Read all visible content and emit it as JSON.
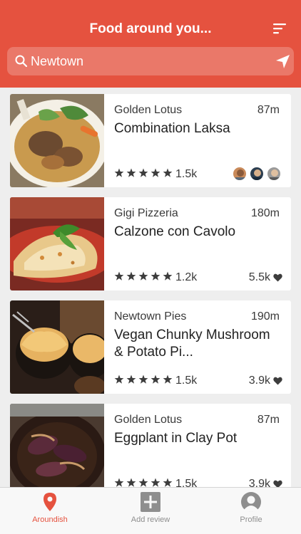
{
  "header": {
    "title": "Food around you..."
  },
  "search": {
    "value": "Newtown"
  },
  "colors": {
    "brand": "#e5523f",
    "active_tab": "#e5523f",
    "inactive_tab": "#8e8e8e"
  },
  "cards": [
    {
      "restaurant": "Golden Lotus",
      "distance": "87m",
      "dish": "Combination Laksa",
      "stars": 5,
      "reviews": "1.5k",
      "likes": "",
      "image": "laksa"
    },
    {
      "restaurant": "Gigi Pizzeria",
      "distance": "180m",
      "dish": "Calzone con Cavolo",
      "stars": 5,
      "reviews": "1.2k",
      "likes": "5.5k",
      "image": "calzone"
    },
    {
      "restaurant": "Newtown Pies",
      "distance": "190m",
      "dish": "Vegan Chunky Mushroom & Potato Pi...",
      "stars": 5,
      "reviews": "1.5k",
      "likes": "3.9k",
      "image": "pies"
    },
    {
      "restaurant": "Golden Lotus",
      "distance": "87m",
      "dish": "Eggplant in Clay Pot",
      "stars": 5,
      "reviews": "1.5k",
      "likes": "3.9k",
      "image": "eggplant"
    }
  ],
  "tabs": [
    {
      "label": "Aroundish",
      "icon": "location-pin-icon",
      "active": true
    },
    {
      "label": "Add review",
      "icon": "plus-square-icon",
      "active": false
    },
    {
      "label": "Profile",
      "icon": "person-icon",
      "active": false
    }
  ]
}
